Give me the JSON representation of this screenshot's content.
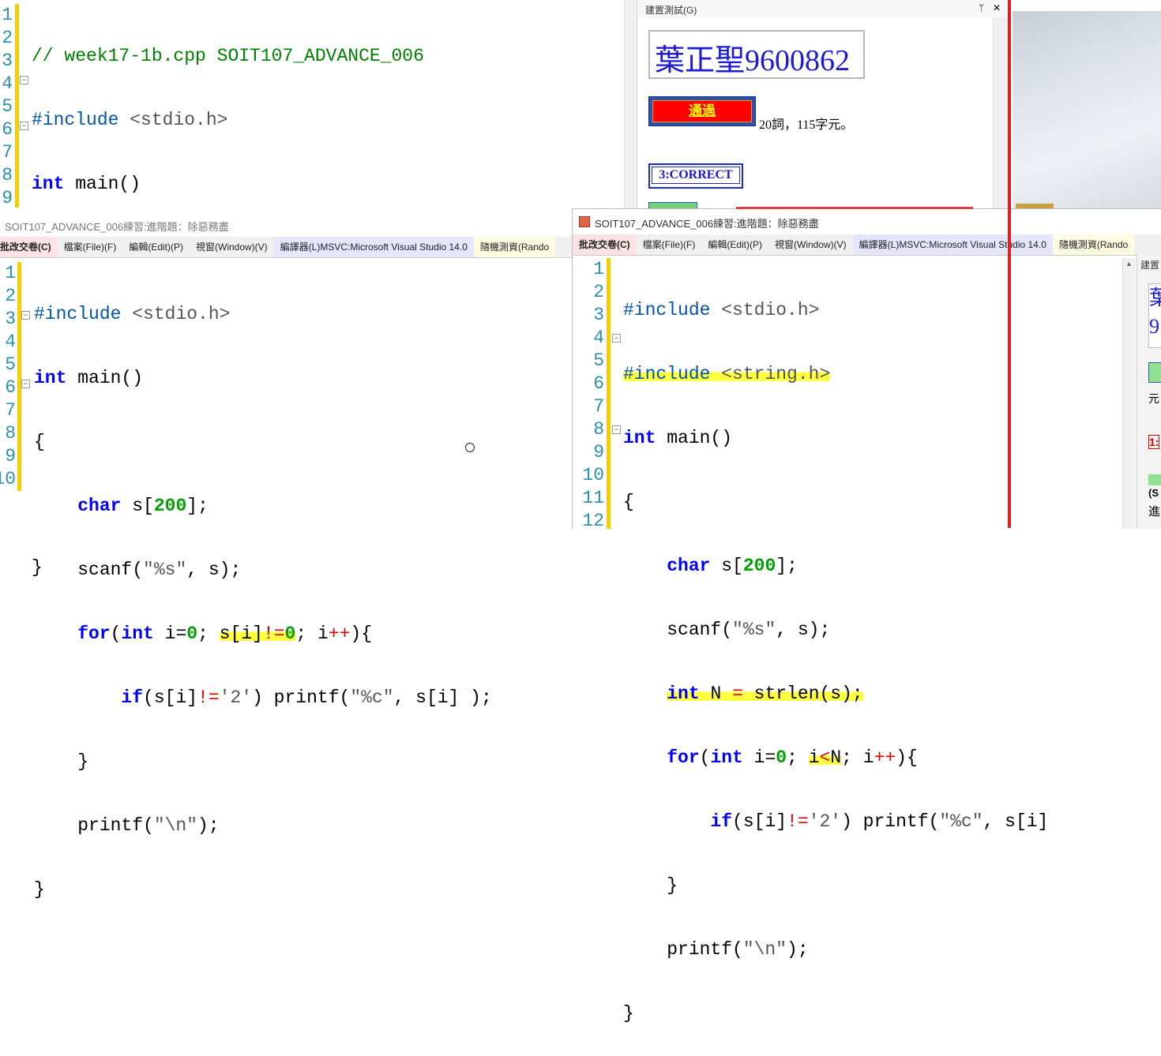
{
  "editor_top": {
    "lines": [
      "1",
      "2",
      "3",
      "4",
      "5",
      "6",
      "7",
      "8",
      "9"
    ]
  },
  "test_panel": {
    "title": "建置測試(G)",
    "pin": "ᛘ",
    "close": "✕",
    "name_box": "葉正聖9600862",
    "pass_label": "通過",
    "stats": "20詞，115字元。",
    "correct_label": "3:CORRECT"
  },
  "window_left": {
    "title": "SOIT107_ADVANCE_006練習:進階題：除惡務盡",
    "menu": [
      "批改交卷(C)",
      "檔案(File)(F)",
      "編輯(Edit)(P)",
      "視窗(Window)(V)",
      "編譯器(L)MSVC:Microsoft Visual Studio 14.0",
      "隨機測資(Rando"
    ],
    "lines": [
      "1",
      "2",
      "3",
      "4",
      "5",
      "6",
      "7",
      "8",
      "9",
      "10"
    ]
  },
  "window_right": {
    "title": "SOIT107_ADVANCE_006練習:進階題：除惡務盡",
    "menu": [
      "批改交卷(C)",
      "檔案(File)(F)",
      "編輯(Edit)(P)",
      "視窗(Window)(V)",
      "編譯器(L)MSVC:Microsoft Visual Studio 14.0",
      "隨機測資(Rando"
    ],
    "lines": [
      "1",
      "2",
      "3",
      "4",
      "5",
      "6",
      "7",
      "8",
      "9",
      "10",
      "11",
      "12"
    ],
    "side_label": "建置",
    "side_texts": [
      "元",
      "1:",
      "(S",
      "進"
    ]
  },
  "colors": {
    "keyword": "#0000ff",
    "highlight": "#ffff40",
    "red_line": "#e02020"
  }
}
